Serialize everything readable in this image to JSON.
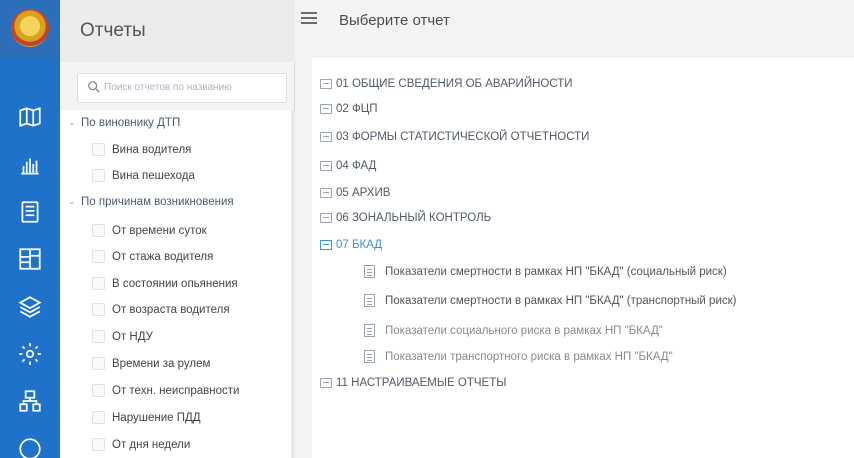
{
  "sidebar": {
    "icons": [
      "emblem-icon",
      "map-icon",
      "bar-chart-icon",
      "document-icon",
      "dashboard-icon",
      "layers-icon",
      "settings-icon",
      "org-structure-icon",
      "circle-icon"
    ]
  },
  "reports_panel": {
    "title": "Отчеты",
    "search_placeholder": "Поиск отчетов по названию",
    "tree": [
      {
        "label": "По виновнику ДТП",
        "children": [
          "Вина водителя",
          "Вина пешехода"
        ]
      },
      {
        "label": "По причинам возникновения",
        "children": [
          "От времени суток",
          "От стажа водителя",
          "В состоянии опьянения",
          "От возраста водителя",
          "От НДУ",
          "Времени за рулем",
          "От техн. неисправности",
          "Нарушение ПДД",
          "От дня недели"
        ]
      }
    ]
  },
  "header": {
    "title": "Выберите отчет"
  },
  "main": {
    "folders": [
      {
        "label": "01 ОБЩИЕ СВЕДЕНИЯ ОБ АВАРИЙНОСТИ"
      },
      {
        "label": "02 ФЦП"
      },
      {
        "label": "03 ФОРМЫ СТАТИСТИЧЕСКОЙ ОТЧЕТНОСТИ"
      },
      {
        "label": "04 ФАД"
      },
      {
        "label": "05 АРХИВ"
      },
      {
        "label": "06 ЗОНАЛЬНЫЙ КОНТРОЛЬ"
      },
      {
        "label": "07 БКАД",
        "expanded": true,
        "reports": [
          "Показатели смертности в рамках НП \"БКАД\" (социальный риск)",
          "Показатели смертности в рамках НП \"БКАД\" (транспортный риск)",
          "Показатели социального риска в рамках НП \"БКАД\"",
          "Показатели транспортного риска в рамках НП \"БКАД\""
        ]
      },
      {
        "label": "11 НАСТРАИВАЕМЫЕ ОТЧЕТЫ"
      }
    ]
  },
  "colors": {
    "rail": "#1f72c9",
    "accent": "#3b8fd8"
  }
}
